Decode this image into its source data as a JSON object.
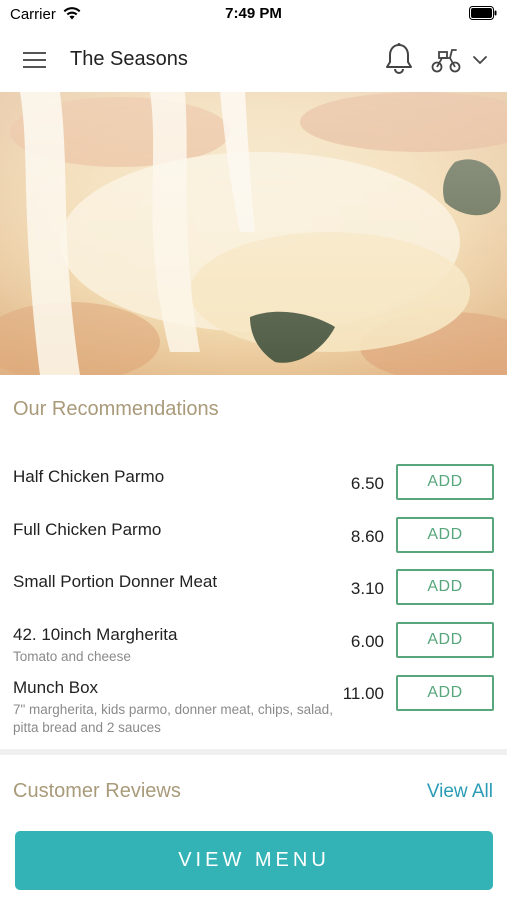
{
  "status_bar": {
    "carrier": "Carrier",
    "time": "7:49 PM"
  },
  "header": {
    "title": "The Seasons",
    "icons": [
      "menu-icon",
      "bell-icon",
      "scooter-icon",
      "chevron-down-icon"
    ]
  },
  "recommendations": {
    "title": "Our Recommendations",
    "add_label": "ADD",
    "items": [
      {
        "name": "Half Chicken Parmo",
        "description": "",
        "price": "6.50"
      },
      {
        "name": "Full Chicken Parmo",
        "description": "",
        "price": "8.60"
      },
      {
        "name": "Small Portion Donner Meat",
        "description": "",
        "price": "3.10"
      },
      {
        "name": "42. 10inch Margherita",
        "description": "Tomato and cheese",
        "price": "6.00"
      },
      {
        "name": "Munch Box",
        "description": "7\" margherita, kids parmo, donner meat, chips, salad, pitta bread and 2 sauces",
        "price": "11.00"
      }
    ]
  },
  "reviews": {
    "title": "Customer Reviews",
    "view_all": "View All"
  },
  "footer": {
    "view_menu": "VIEW MENU"
  },
  "colors": {
    "accent_teal": "#33b3b6",
    "add_green": "#58a67c",
    "section_title": "#a99a7a",
    "link_blue": "#2a9cb5"
  }
}
